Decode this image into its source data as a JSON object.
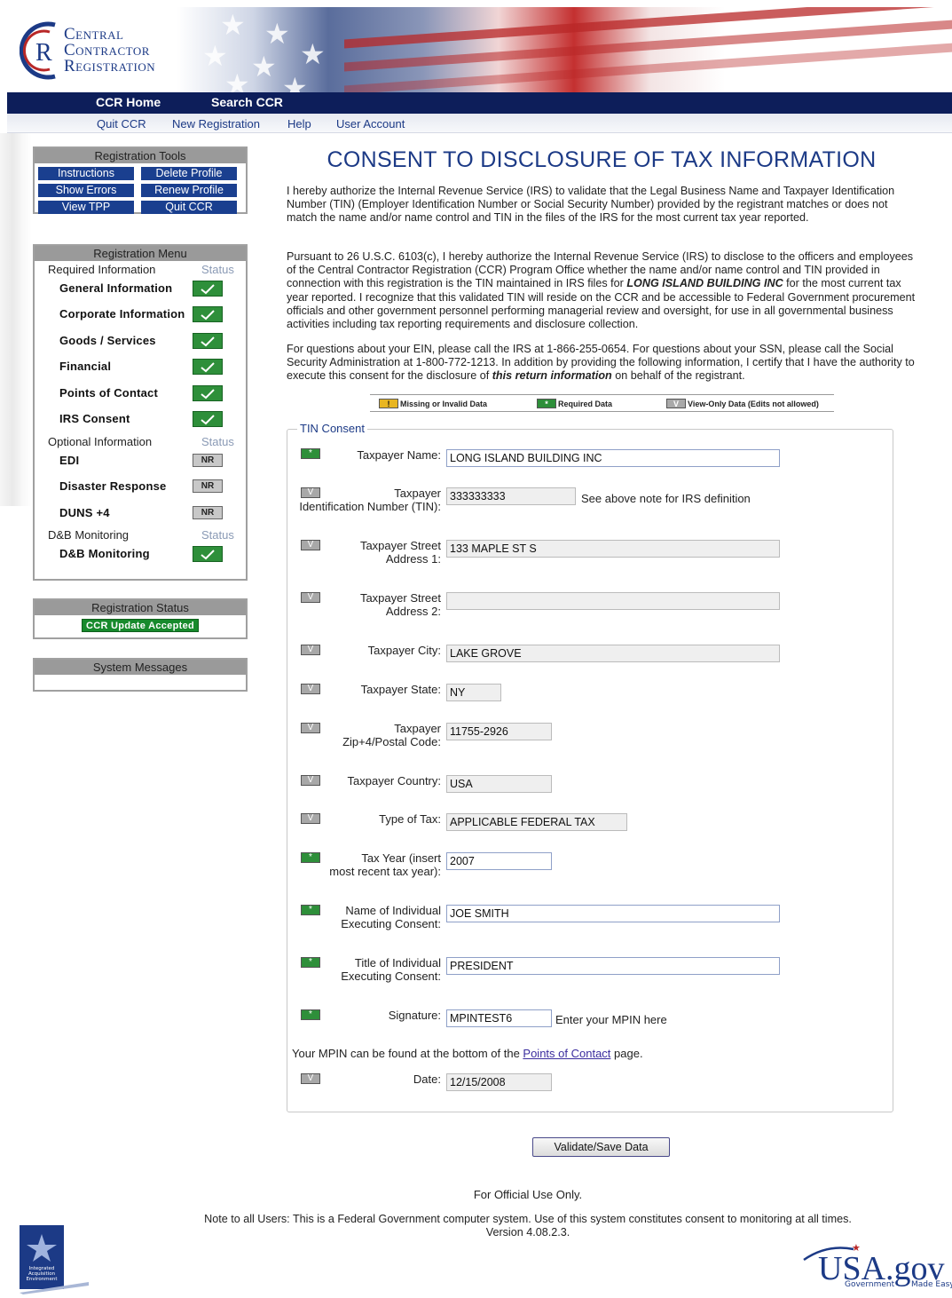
{
  "header": {
    "logo_line1": "Central",
    "logo_line2": "Contractor",
    "logo_line3": "Registration",
    "logo_mark": "CR",
    "nav_primary": [
      "CCR Home",
      "Search CCR"
    ],
    "nav_secondary": [
      "Quit CCR",
      "New Registration",
      "Help",
      "User Account"
    ]
  },
  "tools": {
    "heading": "Registration Tools",
    "buttons": [
      "Instructions",
      "Delete Profile",
      "Show Errors",
      "Renew Profile",
      "View TPP",
      "Quit CCR"
    ]
  },
  "menu": {
    "heading": "Registration Menu",
    "required_label": "Required Information",
    "optional_label": "Optional Information",
    "dnb_label": "D&B Monitoring",
    "status_label": "Status",
    "required_items": [
      "General Information",
      "Corporate Information",
      "Goods / Services",
      "Financial",
      "Points of Contact",
      "IRS Consent"
    ],
    "optional_items": [
      "EDI",
      "Disaster Response",
      "DUNS +4"
    ],
    "optional_status": "NR",
    "dnb_items": [
      "D&B Monitoring"
    ],
    "complete_icon": "check-icon"
  },
  "reg_status": {
    "heading": "Registration Status",
    "badge": "CCR Update Accepted"
  },
  "system_messages": {
    "heading": "System Messages"
  },
  "page": {
    "title": "CONSENT TO DISCLOSURE OF TAX INFORMATION",
    "para1": "I hereby authorize the Internal Revenue Service (IRS) to validate that the Legal Business Name and Taxpayer Identification Number (TIN) (Employer Identification Number or Social Security Number) provided by the registrant matches or does not match the name and/or name control and TIN in the files of the IRS for the most current tax year reported.",
    "para2_a": "Pursuant to 26 U.S.C. 6103(c), I hereby authorize the Internal Revenue Service (IRS) to disclose to the officers and employees of the Central Contractor Registration (CCR) Program Office whether the name and/or name control and TIN provided in connection with this registration is the TIN maintained in IRS files for ",
    "para2_b": "LONG ISLAND BUILDING INC",
    "para2_c": " for the most current tax year reported. I recognize that this validated TIN will reside on the CCR and be accessible to Federal Government procurement officials and other government personnel performing managerial review and oversight, for use in all governmental business activities including tax reporting requirements and disclosure collection.",
    "para3_a": "For questions about your EIN, please call the IRS at 1-866-255-0654. For questions about your SSN, please call the Social Security Administration at 1-800-772-1213. In addition by providing the following information, I certify that I have the authority to execute this consent for the disclosure of ",
    "para3_b": "this return information",
    "para3_c": " on behalf of the registrant."
  },
  "legend": {
    "missing": "Missing or Invalid Data",
    "required": "Required Data",
    "viewonly": "View-Only Data (Edits not allowed)",
    "missing_sym": "!",
    "required_sym": "*",
    "viewonly_sym": "V"
  },
  "colors": {
    "required": "#2e8f3a",
    "viewonly": "#a8a8a8",
    "missing": "#e8b622",
    "accent": "#1c3a86",
    "nav": "#0d1e5a"
  },
  "form": {
    "legend": "TIN Consent",
    "fields": [
      {
        "label1": "Taxpayer Name:",
        "label2": "",
        "value": "LONG ISLAND BUILDING INC",
        "kind": "*"
      },
      {
        "label1": "Taxpayer",
        "label2": "Identification Number (TIN):",
        "value": "333333333",
        "kind": "V"
      },
      {
        "label1": "Taxpayer Street",
        "label2": "Address 1:",
        "value": "133 MAPLE ST S",
        "kind": "V"
      },
      {
        "label1": "Taxpayer Street",
        "label2": "Address 2:",
        "value": "",
        "kind": "V"
      },
      {
        "label1": "Taxpayer City:",
        "label2": "",
        "value": "LAKE GROVE",
        "kind": "V"
      },
      {
        "label1": "Taxpayer State:",
        "label2": "",
        "value": "NY",
        "kind": "V"
      },
      {
        "label1": "Taxpayer",
        "label2": "Zip+4/Postal Code:",
        "value": "11755-2926",
        "kind": "V"
      },
      {
        "label1": "Taxpayer Country:",
        "label2": "",
        "value": "USA",
        "kind": "V"
      },
      {
        "label1": "Type of Tax:",
        "label2": "",
        "value": "APPLICABLE FEDERAL TAX",
        "kind": "V"
      },
      {
        "label1": "Tax Year (insert",
        "label2": "most recent tax year):",
        "value": "2007",
        "kind": "*"
      },
      {
        "label1": "Name of Individual",
        "label2": "Executing Consent:",
        "value": "JOE SMITH",
        "kind": "*"
      },
      {
        "label1": "Title of Individual",
        "label2": "Executing Consent:",
        "value": "PRESIDENT",
        "kind": "*"
      },
      {
        "label1": "Signature:",
        "label2": "",
        "value": "MPINTEST6",
        "kind": "*"
      },
      {
        "label1": "Date:",
        "label2": "",
        "value": "12/15/2008",
        "kind": "V"
      }
    ],
    "tin_note": "See above note for IRS definition",
    "mpin_hint": "Enter your MPIN here",
    "mpin_note_a": "Your MPIN can be found at the bottom of the ",
    "mpin_link": "Points of Contact",
    "mpin_note_b": " page.",
    "save_button": "Validate/Save Data"
  },
  "footer": {
    "official": "For Official Use Only.",
    "notice": "Note to all Users: This is a Federal Government computer system. Use of this system constitutes consent to monitoring at all times.",
    "version": "Version 4.08.2.3.",
    "iae_lines": [
      "Integrated",
      "Acquisition",
      "Environment"
    ],
    "usagov_main": "USA.gov",
    "usagov_tag1": "Government",
    "usagov_tag2": "Made Easy"
  }
}
